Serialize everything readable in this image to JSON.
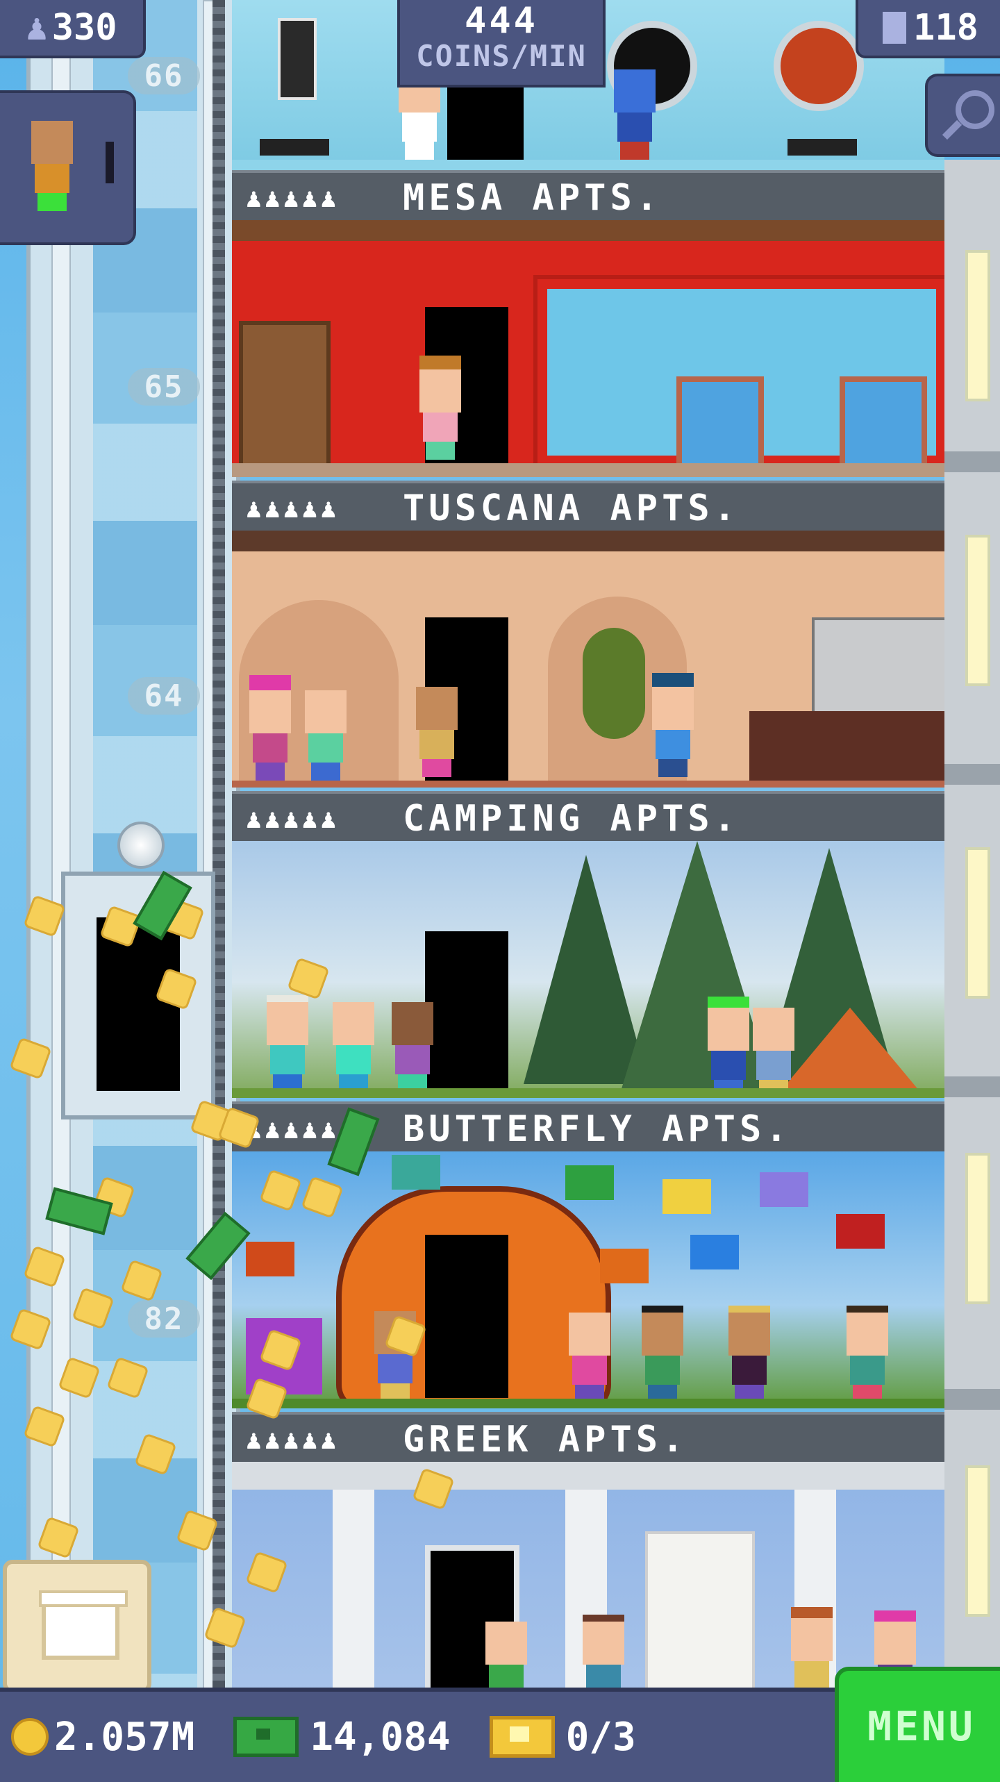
{
  "hud": {
    "population": "330",
    "coins_per_min_value": "444",
    "coins_per_min_unit": "COINS/MIN",
    "floors": "118"
  },
  "floor_numbers": [
    "66",
    "65",
    "64",
    "82"
  ],
  "floors": [
    {
      "name": "MESA APTS.",
      "people_icons": "♟♟♟♟♟"
    },
    {
      "name": "TUSCANA APTS.",
      "people_icons": "♟♟♟♟♟"
    },
    {
      "name": "CAMPING APTS.",
      "people_icons": "♟♟♟♟♟"
    },
    {
      "name": "BUTTERFLY APTS.",
      "people_icons": "♟♟♟♟♟"
    },
    {
      "name": "GREEK APTS.",
      "people_icons": "♟♟♟♟♟"
    }
  ],
  "bottom": {
    "coins": "2.057M",
    "bux": "14,084",
    "tickets": "0/3",
    "menu_label": "MENU"
  },
  "colors": {
    "hud_bg": "#4b5580",
    "menu_green": "#2bcf3a",
    "mesa_red": "#d8261d"
  }
}
